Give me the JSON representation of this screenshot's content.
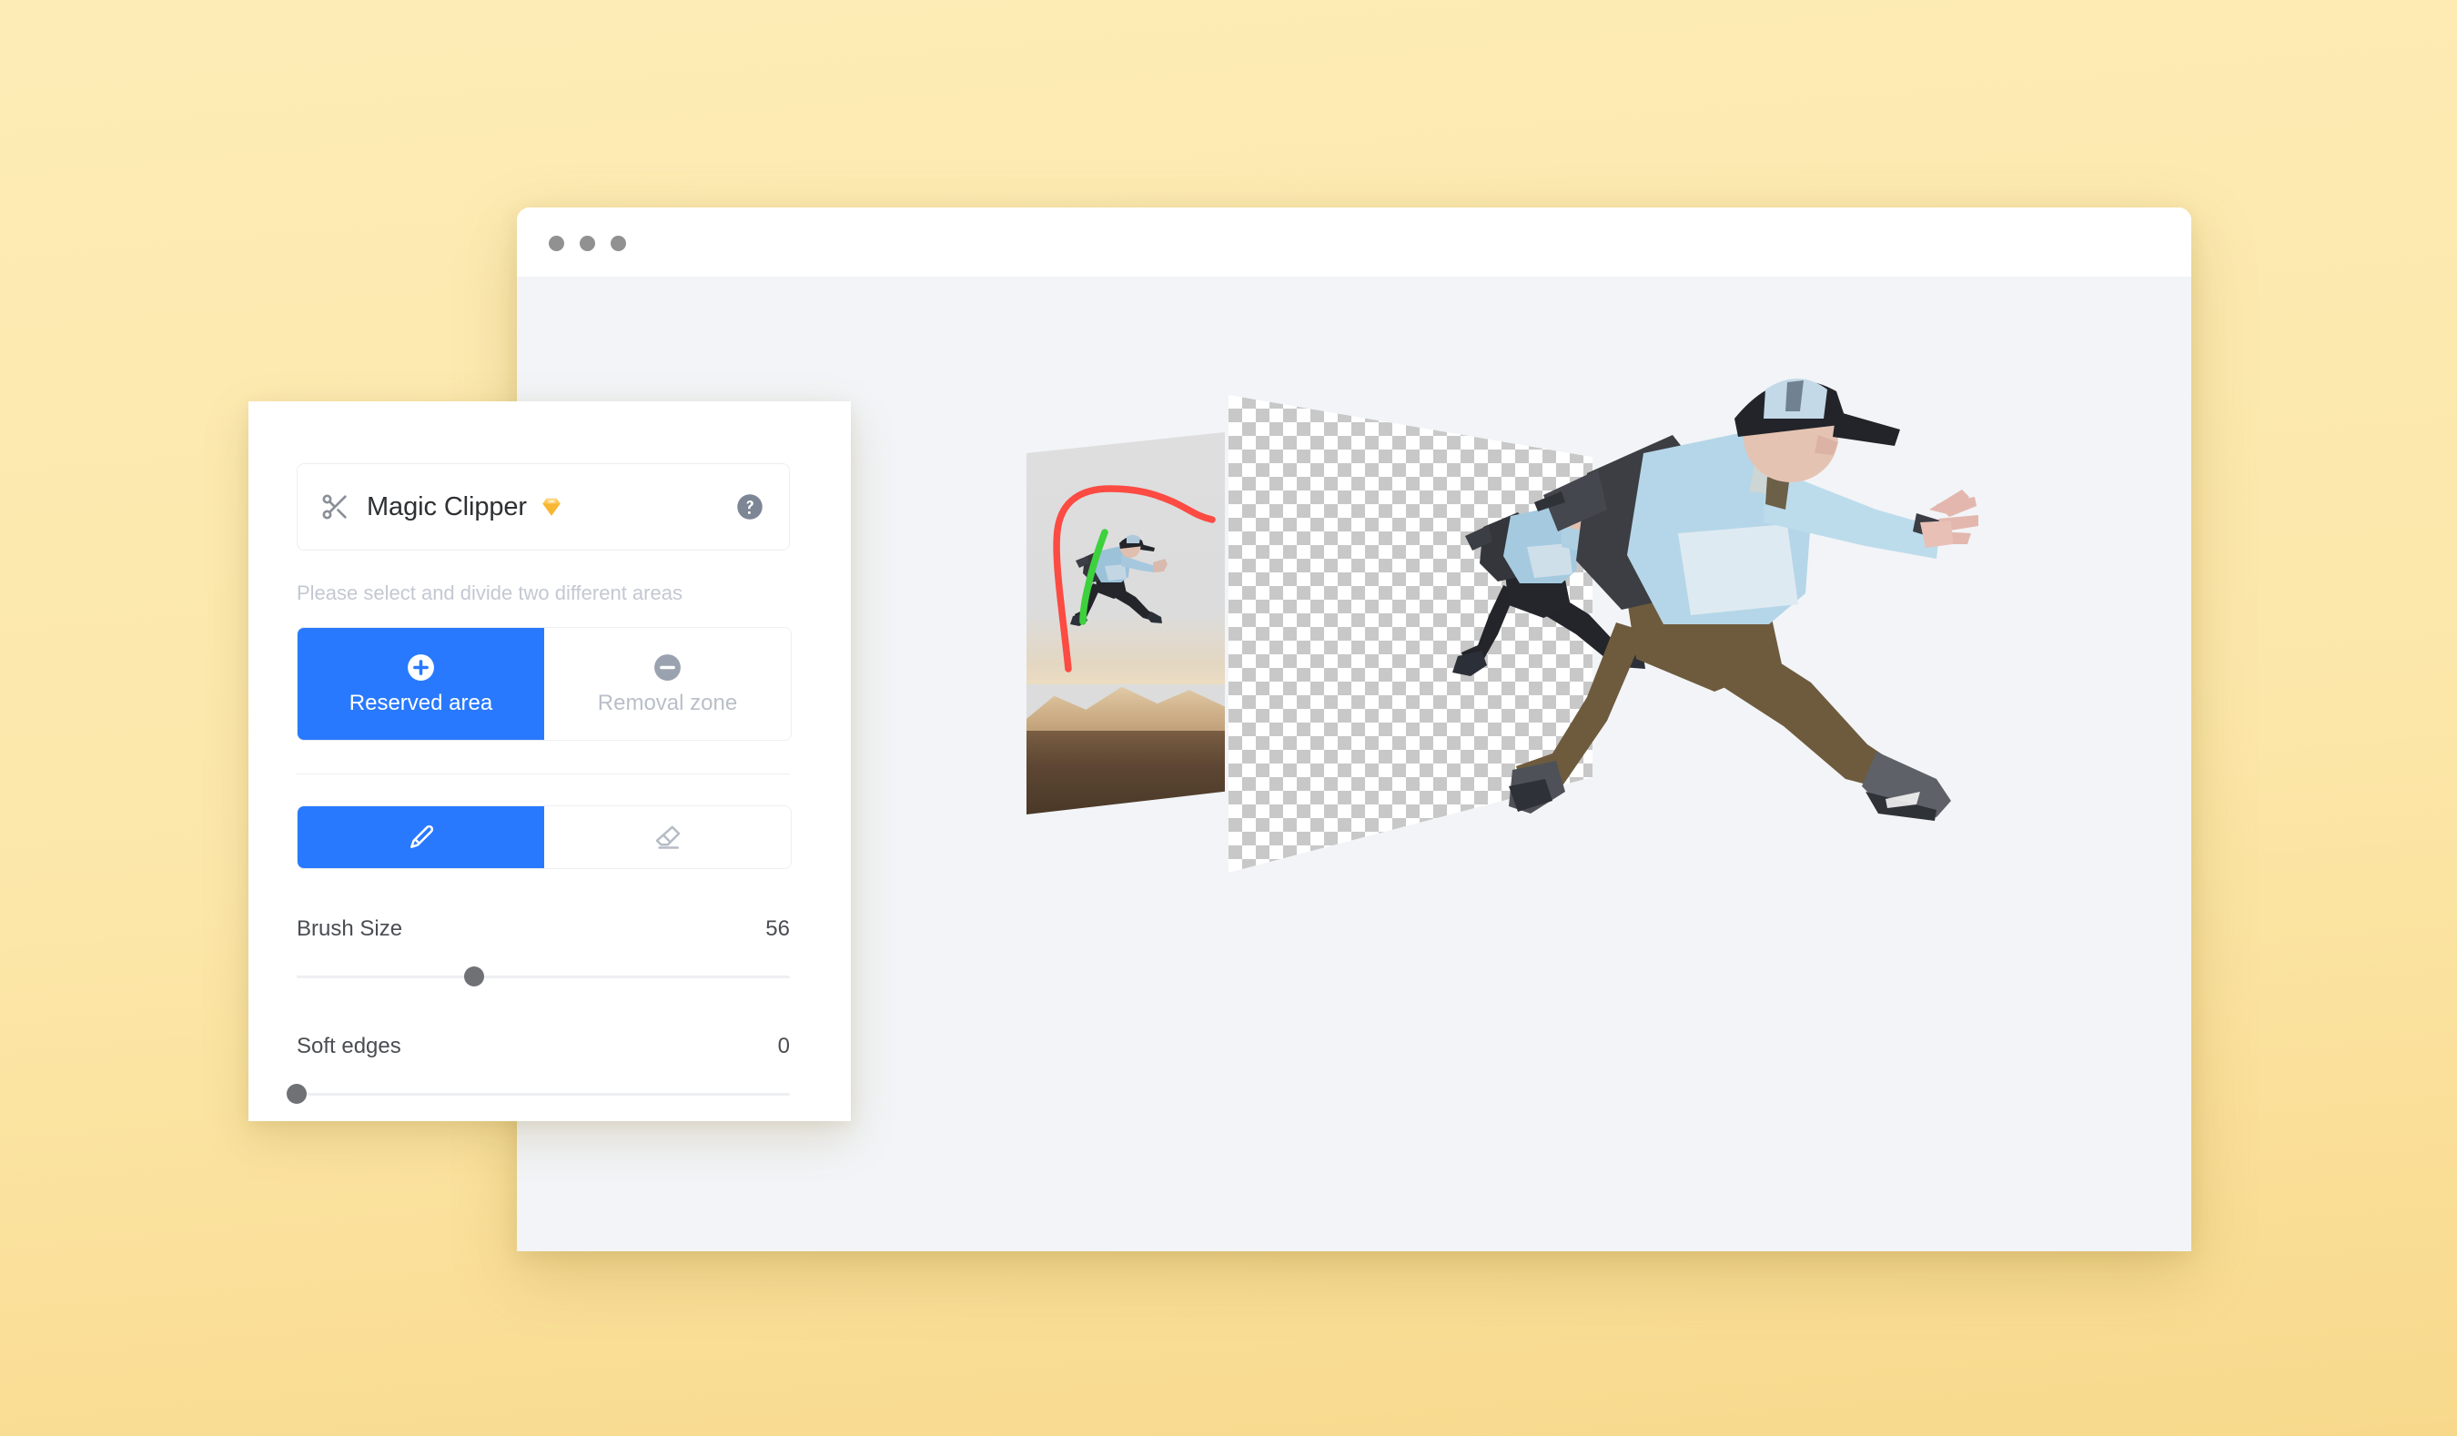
{
  "background": {
    "color_top": "#FDECB6",
    "color_bottom": "#F8D98C"
  },
  "browser_window": {
    "titlebar": {
      "dots": [
        "window-dot",
        "window-dot",
        "window-dot"
      ],
      "dot_color": "#919191"
    },
    "canvas_background": "#F2F4F7"
  },
  "canvas": {
    "original_photo": {
      "name": "original-photo-with-brush-strokes",
      "description": "Photo of a man jumping outdoors at sunset, shown on a perspective-skewed panel",
      "strokes": [
        {
          "name": "removal-zone-stroke",
          "color": "#FB4B42"
        },
        {
          "name": "reserved-area-stroke",
          "color": "#3ED13E"
        }
      ]
    },
    "transparency_panel": {
      "name": "transparency-checkerboard",
      "light_color": "#FFFFFF",
      "dark_color": "#C8C8C8"
    },
    "cutout_subject": {
      "name": "cutout-runner",
      "description": "Man in light blue long-sleeve shirt, cap and backpack mid-jump"
    }
  },
  "tool_panel": {
    "header": {
      "scissors_icon": "scissors-icon",
      "title": "Magic Clipper",
      "premium_icon": "gem-icon",
      "help_icon": "help-icon"
    },
    "instruction": "Please select and divide two different areas",
    "area_modes": [
      {
        "icon": "plus-circle-icon",
        "label": "Reserved area",
        "active": true
      },
      {
        "icon": "minus-circle-icon",
        "label": "Removal zone",
        "active": false
      }
    ],
    "brush_modes": [
      {
        "icon": "brush-icon",
        "active": true
      },
      {
        "icon": "eraser-icon",
        "active": false
      }
    ],
    "sliders": [
      {
        "label": "Brush Size",
        "value": "56",
        "percent": 36
      },
      {
        "label": "Soft edges",
        "value": "0",
        "percent": 0
      }
    ],
    "accent_color": "#2979FF",
    "muted_color": "#B9BFC9"
  }
}
